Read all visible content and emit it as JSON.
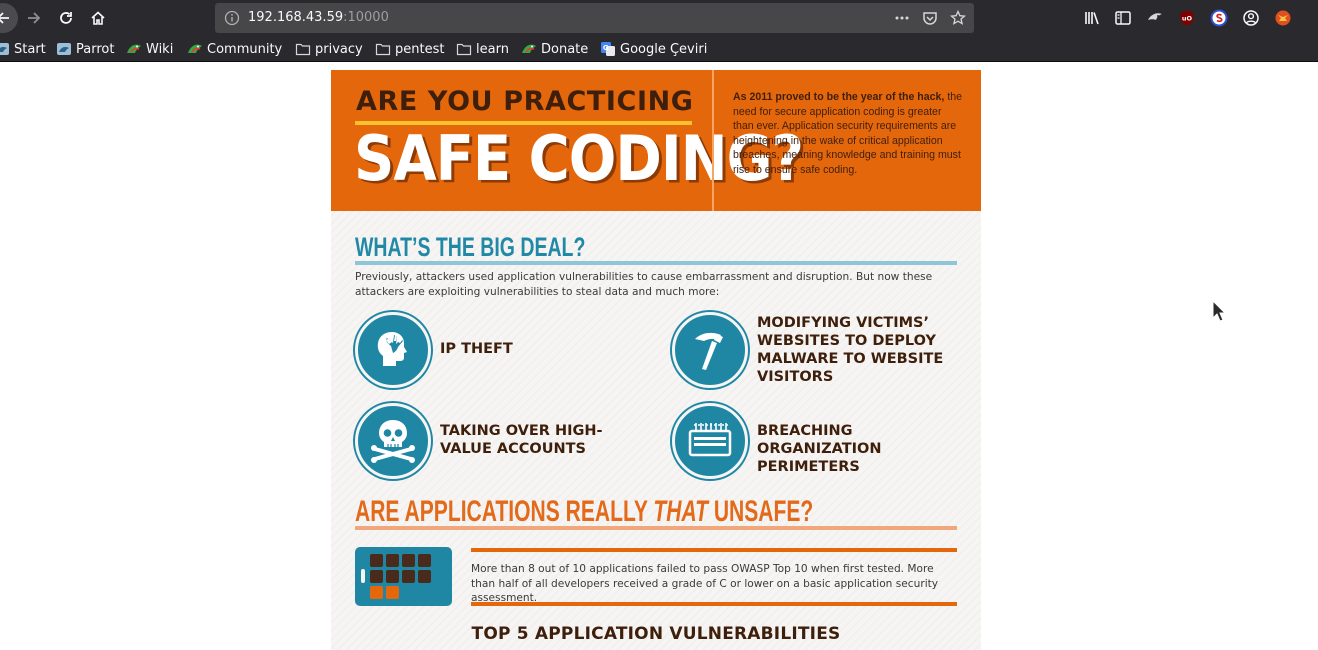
{
  "browser": {
    "url": {
      "host": "192.168.43.59",
      "port": ":10000"
    },
    "bookmarks": [
      {
        "label": "Start",
        "icon": "parrot-icon"
      },
      {
        "label": "Parrot",
        "icon": "parrot-icon"
      },
      {
        "label": "Wiki",
        "icon": "parrot-icon"
      },
      {
        "label": "Community",
        "icon": "parrot-icon"
      },
      {
        "label": "privacy",
        "icon": "folder-icon"
      },
      {
        "label": "pentest",
        "icon": "folder-icon"
      },
      {
        "label": "learn",
        "icon": "folder-icon"
      },
      {
        "label": "Donate",
        "icon": "parrot-icon"
      },
      {
        "label": "Google Çeviri",
        "icon": "google-translate-icon"
      }
    ]
  },
  "page": {
    "hero": {
      "kicker": "ARE YOU PRACTICING",
      "headline": "SAFE CODING?",
      "intro_bold": "As 2011 proved to be the year of the hack,",
      "intro_rest": " the need for secure application coding is greater than ever. Application security requirements are heightening in the wake of critical application breaches, meaning knowledge and training must rise to ensure safe coding."
    },
    "big_deal": {
      "title": "WHAT’S THE BIG DEAL?",
      "lead": "Previously, attackers used application vulnerabilities to cause embarrassment and disruption. But now these attackers are exploiting vulnerabilities to steal data and much more:",
      "threats": [
        {
          "label": "IP THEFT",
          "icon": "hand-head-icon"
        },
        {
          "label": "MODIFYING VICTIMS’ WEBSITES TO DEPLOY MALWARE TO WEBSITE VISITORS",
          "icon": "hammer-icon"
        },
        {
          "label": "TAKING OVER HIGH-VALUE ACCOUNTS",
          "icon": "skull-crossbones-icon"
        },
        {
          "label": "BREACHING ORGANIZATION PERIMETERS",
          "icon": "firewall-icon"
        }
      ]
    },
    "unsafe": {
      "title_start": "ARE APPLICATIONS REALLY ",
      "title_em": "THAT",
      "title_end": " UNSAFE?",
      "stat": "More than 8 out of 10 applications failed to pass OWASP Top 10 when first tested. More than half of all developers received a grade of C or lower on a basic application security assessment."
    },
    "top5_title": "TOP 5 APPLICATION VULNERABILITIES"
  },
  "colors": {
    "hero_orange": "#e5670c",
    "teal": "#1f87a4",
    "dark_brown": "#3e1f0b",
    "chrome_dark": "#2a2a2e"
  }
}
